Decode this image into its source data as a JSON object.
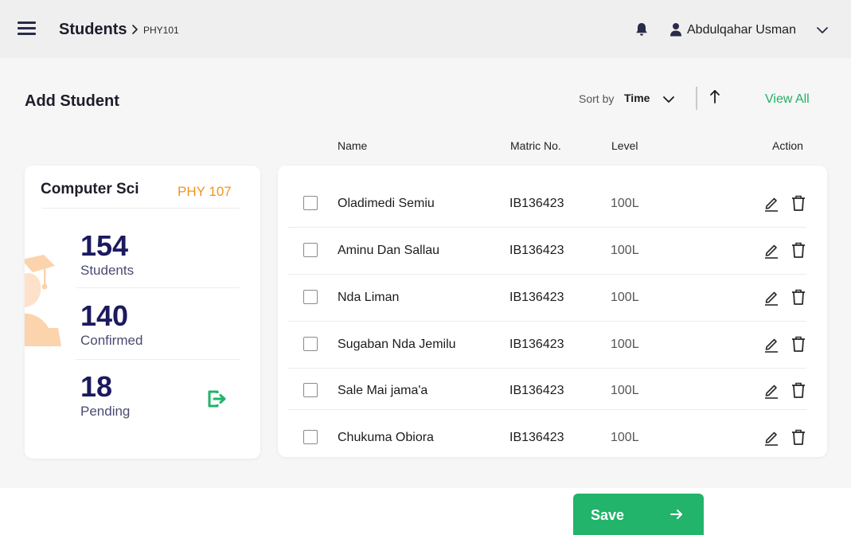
{
  "header": {
    "title": "Students",
    "breadcrumb": "PHY101",
    "user_name": "Abdulqahar Usman",
    "icons": [
      "menu-icon",
      "chevron-right-icon",
      "bell-icon",
      "user-icon",
      "chevron-down-icon"
    ]
  },
  "toolbar": {
    "page_title": "Add Student",
    "sort_label": "Sort by",
    "sort_value": "Time",
    "view_all": "View All"
  },
  "columns": {
    "name": "Name",
    "matric": "Matric No.",
    "level": "Level",
    "action": "Action"
  },
  "course_card": {
    "title": "Computer Sci",
    "code": "PHY 107",
    "stats": [
      {
        "value": "154",
        "label": "Students"
      },
      {
        "value": "140",
        "label": "Confirmed"
      },
      {
        "value": "18",
        "label": "Pending"
      }
    ]
  },
  "students": [
    {
      "name": "Oladimedi Semiu",
      "matric": "IB136423",
      "level": "100L"
    },
    {
      "name": "Aminu Dan Sallau",
      "matric": "IB136423",
      "level": "100L"
    },
    {
      "name": "Nda Liman",
      "matric": "IB136423",
      "level": "100L"
    },
    {
      "name": "Sugaban Nda Jemilu",
      "matric": "IB136423",
      "level": "100L"
    },
    {
      "name": "Sale Mai jama'a",
      "matric": "IB136423",
      "level": "100L"
    },
    {
      "name": "Chukuma Obiora",
      "matric": "IB136423",
      "level": "100L"
    }
  ],
  "footer": {
    "save_label": "Save"
  },
  "colors": {
    "accent_green": "#21b46a",
    "accent_orange": "#f0941d",
    "stat_navy": "#1c1a5e",
    "header_bg": "#efefef",
    "content_bg": "#f6f6f6"
  }
}
